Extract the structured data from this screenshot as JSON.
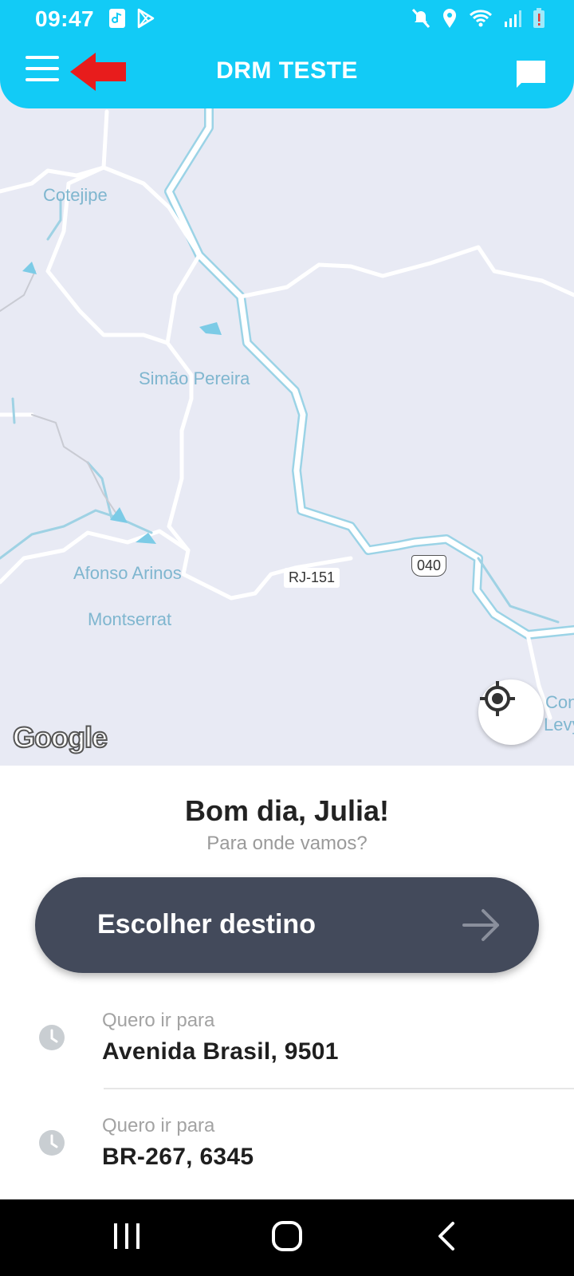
{
  "status_bar": {
    "time": "09:47",
    "icons": [
      "music-note-icon",
      "play-store-icon",
      "mute-icon",
      "location-icon",
      "wifi-icon",
      "signal-icon",
      "battery-alert-icon"
    ]
  },
  "app_bar": {
    "title": "DRM TESTE",
    "menu_icon": "hamburger-menu-icon",
    "chat_icon": "chat-icon"
  },
  "map": {
    "labels": {
      "cotejipe": "Cotejipe",
      "simao_pereira": "Simão Pereira",
      "afonso_arinos": "Afonso Arinos",
      "montserrat": "Montserrat",
      "comendador_levy_1": "Con",
      "comendador_levy_2": "Levy"
    },
    "road_shields": {
      "rj151": "RJ-151",
      "br040": "040"
    },
    "attribution": "Google"
  },
  "sheet": {
    "greeting": "Bom dia, Julia!",
    "subtitle": "Para onde vamos?",
    "destination_button": "Escolher destino",
    "recent": [
      {
        "kicker": "Quero ir para",
        "address": "Avenida Brasil, 9501"
      },
      {
        "kicker": "Quero ir para",
        "address": "BR-267, 6345"
      }
    ]
  },
  "colors": {
    "header": "#12cbf6",
    "button": "#434a5b",
    "map_bg": "#e8eaf4",
    "annotation_arrow": "#e81c1c"
  }
}
